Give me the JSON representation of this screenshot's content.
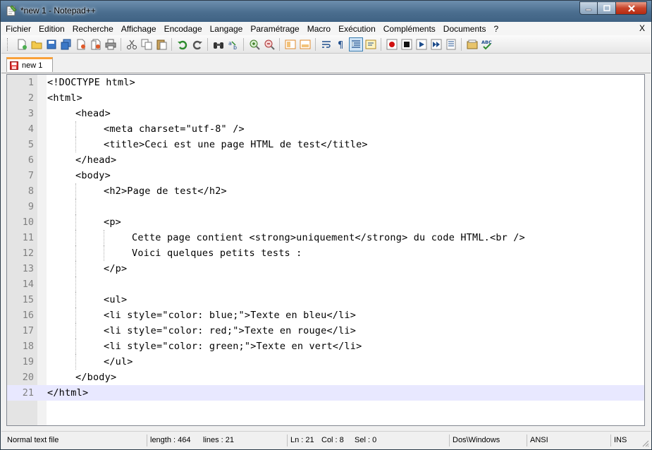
{
  "window": {
    "title": "*new  1 - Notepad++"
  },
  "menu": {
    "items": [
      "Fichier",
      "Edition",
      "Recherche",
      "Affichage",
      "Encodage",
      "Langage",
      "Paramétrage",
      "Macro",
      "Exécution",
      "Compléments",
      "Documents",
      "?"
    ],
    "close_label": "X"
  },
  "toolbar": {
    "buttons": [
      "new-file",
      "open-file",
      "save",
      "save-all",
      "close",
      "close-all",
      "print",
      "cut",
      "copy",
      "paste",
      "undo",
      "redo",
      "find",
      "replace",
      "zoom-in",
      "zoom-out",
      "sync-vertical",
      "sync-horizontal",
      "word-wrap",
      "show-all-chars",
      "indent-guide",
      "user-define-lang",
      "record-macro",
      "stop-macro",
      "play-macro",
      "run-macro-multiple",
      "save-macro",
      "trim",
      "spellcheck"
    ]
  },
  "tabs": [
    {
      "label": "new  1",
      "modified": true
    }
  ],
  "editor": {
    "lines": [
      {
        "n": "1",
        "text": "<!DOCTYPE html>",
        "indent": 0
      },
      {
        "n": "2",
        "text": "<html>",
        "indent": 0
      },
      {
        "n": "3",
        "text": "<head>",
        "indent": 1
      },
      {
        "n": "4",
        "text": "<meta charset=\"utf-8\" />",
        "indent": 2
      },
      {
        "n": "5",
        "text": "<title>Ceci est une page HTML de test</title>",
        "indent": 2
      },
      {
        "n": "6",
        "text": "</head>",
        "indent": 1
      },
      {
        "n": "7",
        "text": "<body>",
        "indent": 1
      },
      {
        "n": "8",
        "text": "<h2>Page de test</h2>",
        "indent": 2
      },
      {
        "n": "9",
        "text": "",
        "indent": 2
      },
      {
        "n": "10",
        "text": "<p>",
        "indent": 2
      },
      {
        "n": "11",
        "text": "Cette page contient <strong>uniquement</strong> du code HTML.<br />",
        "indent": 3
      },
      {
        "n": "12",
        "text": "Voici quelques petits tests :",
        "indent": 3
      },
      {
        "n": "13",
        "text": "</p>",
        "indent": 2
      },
      {
        "n": "14",
        "text": "",
        "indent": 2
      },
      {
        "n": "15",
        "text": "<ul>",
        "indent": 2
      },
      {
        "n": "16",
        "text": "<li style=\"color: blue;\">Texte en bleu</li>",
        "indent": 2
      },
      {
        "n": "17",
        "text": "<li style=\"color: red;\">Texte en rouge</li>",
        "indent": 2
      },
      {
        "n": "18",
        "text": "<li style=\"color: green;\">Texte en vert</li>",
        "indent": 2
      },
      {
        "n": "19",
        "text": "</ul>",
        "indent": 2
      },
      {
        "n": "20",
        "text": "</body>",
        "indent": 1
      },
      {
        "n": "21",
        "text": "</html>",
        "indent": 0
      }
    ],
    "current_line": "21"
  },
  "status": {
    "file_type": "Normal text file",
    "length": "length : 464",
    "lines": "lines : 21",
    "ln": "Ln : 21",
    "col": "Col : 8",
    "sel": "Sel : 0",
    "eol": "Dos\\Windows",
    "encoding": "ANSI",
    "mode": "INS"
  },
  "colors": {
    "current_line": "#e8e8ff",
    "tab_accent": "#f9a13a",
    "gutter": "#e4e4e4"
  }
}
